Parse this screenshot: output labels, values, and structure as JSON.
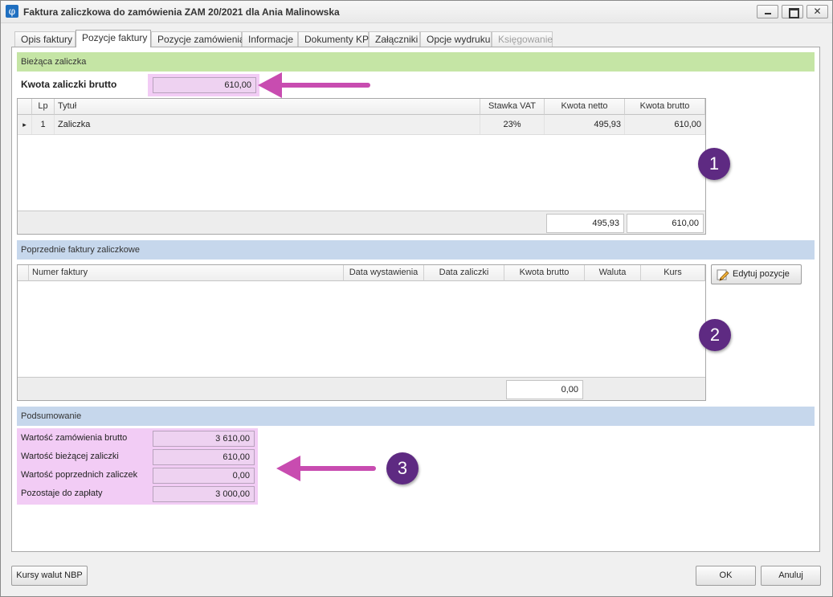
{
  "window": {
    "title": "Faktura zaliczkowa do zamówienia ZAM 20/2021 dla Ania Malinowska",
    "app_icon": "φ",
    "close_glyph": "✕"
  },
  "tabs": [
    {
      "label": "Opis faktury"
    },
    {
      "label": "Pozycje faktury"
    },
    {
      "label": "Pozycje zamówienia"
    },
    {
      "label": "Informacje"
    },
    {
      "label": "Dokumenty KP"
    },
    {
      "label": "Załączniki"
    },
    {
      "label": "Opcje wydruku"
    },
    {
      "label": "Księgowanie"
    }
  ],
  "current": {
    "header": "Bieżąca zaliczka",
    "amount_label": "Kwota zaliczki brutto",
    "amount_value": "610,00",
    "columns": [
      "Lp",
      "Tytuł",
      "Stawka VAT",
      "Kwota netto",
      "Kwota brutto"
    ],
    "row": {
      "lp": "1",
      "title": "Zaliczka",
      "vat": "23%",
      "net": "495,93",
      "gross": "610,00"
    },
    "row_indicator": "▸",
    "total_net": "495,93",
    "total_gross": "610,00"
  },
  "previous": {
    "header": "Poprzednie faktury zaliczkowe",
    "columns": [
      "Numer faktury",
      "Data wystawienia",
      "Data zaliczki",
      "Kwota brutto",
      "Waluta",
      "Kurs"
    ],
    "total_gross": "0,00",
    "edit_button": "Edytuj pozycje",
    "edit_icon": "pencil-icon"
  },
  "summary": {
    "header": "Podsumowanie",
    "rows": [
      {
        "label": "Wartość zamówienia brutto",
        "value": "3 610,00"
      },
      {
        "label": "Wartość bieżącej zaliczki",
        "value": "610,00"
      },
      {
        "label": "Wartość poprzednich zaliczek",
        "value": "0,00"
      },
      {
        "label": "Pozostaje do zapłaty",
        "value": "3 000,00"
      }
    ]
  },
  "annotations": {
    "badge1": "1",
    "badge2": "2",
    "badge3": "3",
    "accent": "#c84cb0",
    "badge_color": "#5e2a82"
  },
  "footer": {
    "nbp_button": "Kursy walut NBP",
    "ok_button": "OK",
    "cancel_button": "Anuluj"
  }
}
